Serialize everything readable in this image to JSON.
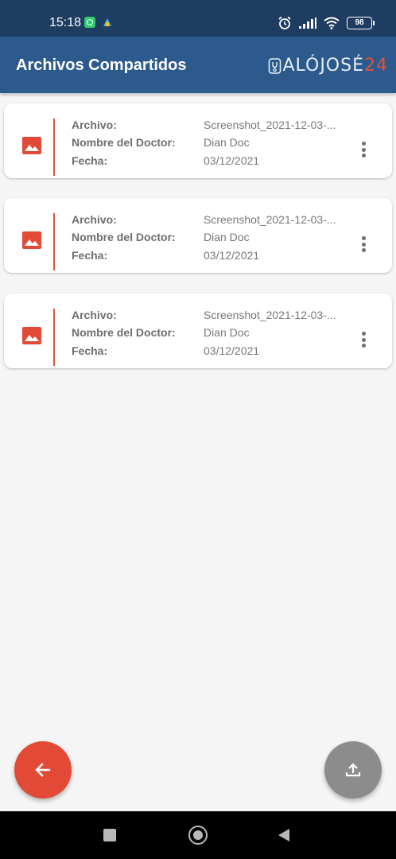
{
  "status_bar": {
    "time": "15:18",
    "battery": "98",
    "icons": [
      "whatsapp-icon",
      "app-notification-icon",
      "alarm-icon",
      "signal-icon",
      "wifi-icon",
      "battery-icon"
    ]
  },
  "app_bar": {
    "title": "Archivos Compartidos",
    "logo_text": "ALÓJOSÉ",
    "logo_number": "24"
  },
  "labels": {
    "archivo": "Archivo:",
    "doctor": "Nombre del Doctor:",
    "fecha": "Fecha:"
  },
  "files": [
    {
      "archivo": "Screenshot_2021-12-03-...",
      "doctor": "Dian Doc",
      "fecha": "03/12/2021"
    },
    {
      "archivo": "Screenshot_2021-12-03-...",
      "doctor": "Dian Doc",
      "fecha": "03/12/2021"
    },
    {
      "archivo": "Screenshot_2021-12-03-...",
      "doctor": "Dian Doc",
      "fecha": "03/12/2021"
    }
  ],
  "colors": {
    "status_bar": "#1f3c61",
    "app_bar": "#2c5a8c",
    "accent": "#e24a37",
    "upload_button": "#8c8c8c",
    "background": "#f5f5f5"
  },
  "fab": {
    "back_icon": "arrow-left-icon",
    "upload_icon": "upload-icon"
  }
}
